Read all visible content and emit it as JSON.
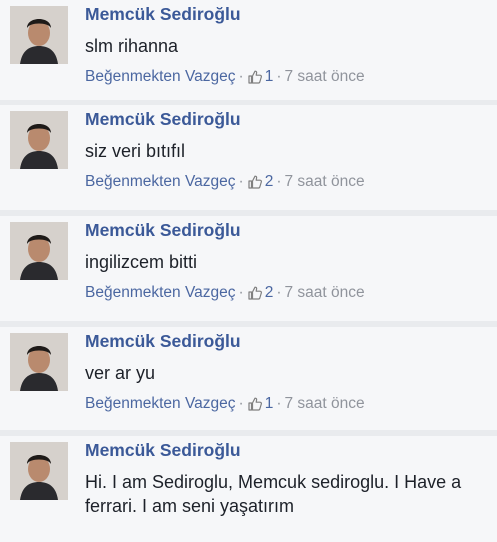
{
  "comments": [
    {
      "author": "Memcük Sediroğlu",
      "text": "slm rihanna",
      "action": "Beğenmekten Vazgeç",
      "likes": "1",
      "time": "7 saat önce",
      "avatar_icon": "profile-photo"
    },
    {
      "author": "Memcük Sediroğlu",
      "text": "siz veri bıtıfıl",
      "action": "Beğenmekten Vazgeç",
      "likes": "2",
      "time": "7 saat önce",
      "avatar_icon": "profile-photo"
    },
    {
      "author": "Memcük Sediroğlu",
      "text": "ingilizcem bitti",
      "action": "Beğenmekten Vazgeç",
      "likes": "2",
      "time": "7 saat önce",
      "avatar_icon": "profile-photo"
    },
    {
      "author": "Memcük Sediroğlu",
      "text": "ver ar yu",
      "action": "Beğenmekten Vazgeç",
      "likes": "1",
      "time": "7 saat önce",
      "avatar_icon": "profile-photo"
    },
    {
      "author": "Memcük Sediroğlu",
      "text": "Hi. I am Sediroglu, Memcuk sediroglu. I Have a ferrari. I am seni yaşatırım",
      "action": "",
      "likes": "",
      "time": "",
      "avatar_icon": "profile-photo"
    }
  ],
  "icons": {
    "like": "thumbs-up-icon",
    "separator": "·"
  },
  "colors": {
    "name": "#3b5998",
    "text": "#1d2129",
    "meta": "#90949c",
    "background": "#f6f7f9"
  }
}
